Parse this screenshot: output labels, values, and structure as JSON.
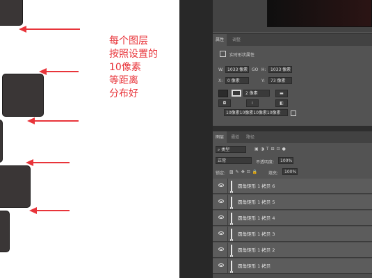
{
  "annotation": {
    "color": "#e8343a",
    "lines": [
      "每个图层",
      "按照设置的",
      "10像素",
      "等距离",
      "分布好"
    ]
  },
  "canvas_shapes": [
    {
      "name": "rounded-rect-1"
    },
    {
      "name": "rounded-rect-2"
    },
    {
      "name": "rounded-rect-3"
    },
    {
      "name": "rounded-rect-4"
    },
    {
      "name": "rounded-rect-5"
    }
  ],
  "properties_panel": {
    "tabs": [
      "属性",
      "调整"
    ],
    "title": "实时形状属性",
    "w_label": "W:",
    "w_value": "1033 像素",
    "link_label": "GO",
    "h_label": "H:",
    "h_value": "1033 像素",
    "x_label": "X:",
    "x_value": "0 像素",
    "y_label": "Y:",
    "y_value": "73 像素",
    "stroke_width": "2 像素",
    "corner_radius_values": [
      "10像素",
      "10像素",
      "10像素",
      "10像素"
    ]
  },
  "layers_panel": {
    "tabs": [
      "图层",
      "通道",
      "路径"
    ],
    "filter_kind": "类型",
    "blend_mode": "正常",
    "opacity_label": "不透明度:",
    "opacity_value": "100%",
    "lock_label": "锁定:",
    "fill_label": "填充:",
    "fill_value": "100%",
    "layers": [
      {
        "name": "圆角矩形 1 拷贝 6"
      },
      {
        "name": "圆角矩形 1 拷贝 5"
      },
      {
        "name": "圆角矩形 1 拷贝 4"
      },
      {
        "name": "圆角矩形 1 拷贝 3"
      },
      {
        "name": "圆角矩形 1 拷贝 2"
      },
      {
        "name": "圆角矩形 1 拷贝"
      }
    ]
  }
}
